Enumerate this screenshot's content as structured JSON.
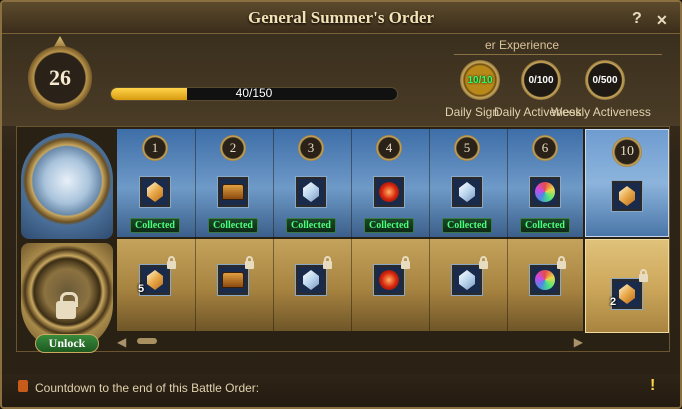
{
  "window": {
    "title": "General Summer's Order",
    "help_label": "?",
    "close_label": "✕"
  },
  "level": {
    "value": "26"
  },
  "xp": {
    "text": "40/150",
    "progress": 0.267
  },
  "experience": {
    "label": "er Experience",
    "circles": [
      {
        "value": "10/10",
        "label": "Daily Sign",
        "state": "done"
      },
      {
        "value": "0/100",
        "label": "Daily Activeness",
        "state": "normal"
      },
      {
        "value": "0/500",
        "label": "Weekly Activeness",
        "state": "normal"
      }
    ]
  },
  "rewards": {
    "columns": [
      {
        "level": "1",
        "free_item": "gold-crystal-icon",
        "free_status": "Collected",
        "paid_item": "gold-crystal-icon",
        "paid_qty": "5"
      },
      {
        "level": "2",
        "free_item": "treasure-chest-icon",
        "free_status": "Collected",
        "paid_item": "treasure-chest-icon",
        "paid_qty": ""
      },
      {
        "level": "3",
        "free_item": "white-crystal-icon",
        "free_status": "Collected",
        "paid_item": "white-crystal-icon",
        "paid_qty": ""
      },
      {
        "level": "4",
        "free_item": "red-orb-icon",
        "free_status": "Collected",
        "paid_item": "red-orb-icon",
        "paid_qty": ""
      },
      {
        "level": "5",
        "free_item": "white-crystal-icon",
        "free_status": "Collected",
        "paid_item": "white-crystal-icon",
        "paid_qty": ""
      },
      {
        "level": "6",
        "free_item": "rainbow-orb-icon",
        "free_status": "Collected",
        "paid_item": "rainbow-orb-icon",
        "paid_qty": ""
      }
    ],
    "milestone": {
      "level": "10",
      "free_item": "gold-crystal-icon",
      "paid_item": "gold-crystal-icon",
      "paid_qty": "2"
    }
  },
  "emblems": {
    "free": "sword-emblem-icon",
    "paid": "locked-emblem-icon",
    "unlock_label": "Unlock"
  },
  "footer": {
    "text": "Countdown to the end of this Battle Order:",
    "warn": "!"
  }
}
